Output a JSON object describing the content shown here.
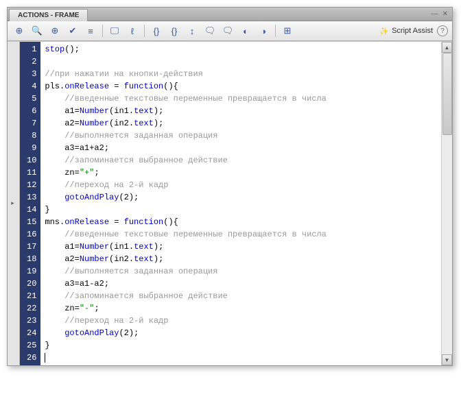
{
  "panel": {
    "title": "ACTIONS - FRAME",
    "script_assist": "Script Assist"
  },
  "toolbar": {
    "icons": [
      "plus-script",
      "find",
      "target",
      "check",
      "format",
      "insert-target",
      "snippet",
      "bracket-in",
      "bracket-out",
      "bracket-swap",
      "comment",
      "uncomment",
      "debug-1",
      "debug-2",
      "debug-3",
      "collapse"
    ],
    "wand": "✨"
  },
  "code": {
    "lines": [
      {
        "n": 1,
        "segs": [
          [
            "fn",
            "stop"
          ],
          [
            "id",
            "();"
          ]
        ]
      },
      {
        "n": 2,
        "segs": []
      },
      {
        "n": 3,
        "segs": [
          [
            "cm",
            "//при нажатии на кнопки-действия"
          ]
        ]
      },
      {
        "n": 4,
        "segs": [
          [
            "id",
            "pls."
          ],
          [
            "fn",
            "onRelease"
          ],
          [
            "id",
            " = "
          ],
          [
            "kw",
            "function"
          ],
          [
            "id",
            "(){"
          ]
        ]
      },
      {
        "n": 5,
        "segs": [
          [
            "id",
            "    "
          ],
          [
            "cm",
            "//введенные текстовые переменные превращается в числа"
          ]
        ]
      },
      {
        "n": 6,
        "segs": [
          [
            "id",
            "    a1="
          ],
          [
            "fn",
            "Number"
          ],
          [
            "id",
            "(in1."
          ],
          [
            "fn",
            "text"
          ],
          [
            "id",
            ");"
          ]
        ]
      },
      {
        "n": 7,
        "segs": [
          [
            "id",
            "    a2="
          ],
          [
            "fn",
            "Number"
          ],
          [
            "id",
            "(in2."
          ],
          [
            "fn",
            "text"
          ],
          [
            "id",
            ");"
          ]
        ]
      },
      {
        "n": 8,
        "segs": [
          [
            "id",
            "    "
          ],
          [
            "cm",
            "//выполняется заданная операция"
          ]
        ]
      },
      {
        "n": 9,
        "segs": [
          [
            "id",
            "    a3=a1+a2;"
          ]
        ]
      },
      {
        "n": 10,
        "segs": [
          [
            "id",
            "    "
          ],
          [
            "cm",
            "//запоминается выбранное действие"
          ]
        ]
      },
      {
        "n": 11,
        "segs": [
          [
            "id",
            "    zn="
          ],
          [
            "str",
            "\"+\""
          ],
          [
            "id",
            ";"
          ]
        ]
      },
      {
        "n": 12,
        "segs": [
          [
            "id",
            "    "
          ],
          [
            "cm",
            "//переход на 2-й кадр"
          ]
        ]
      },
      {
        "n": 13,
        "segs": [
          [
            "id",
            "    "
          ],
          [
            "fn",
            "gotoAndPlay"
          ],
          [
            "id",
            "(2);"
          ]
        ]
      },
      {
        "n": 14,
        "segs": [
          [
            "id",
            "}"
          ]
        ]
      },
      {
        "n": 15,
        "segs": [
          [
            "id",
            "mns."
          ],
          [
            "fn",
            "onRelease"
          ],
          [
            "id",
            " = "
          ],
          [
            "kw",
            "function"
          ],
          [
            "id",
            "(){"
          ]
        ]
      },
      {
        "n": 16,
        "segs": [
          [
            "id",
            "    "
          ],
          [
            "cm",
            "//введенные текстовые переменные превращается в числа"
          ]
        ]
      },
      {
        "n": 17,
        "segs": [
          [
            "id",
            "    a1="
          ],
          [
            "fn",
            "Number"
          ],
          [
            "id",
            "(in1."
          ],
          [
            "fn",
            "text"
          ],
          [
            "id",
            ");"
          ]
        ]
      },
      {
        "n": 18,
        "segs": [
          [
            "id",
            "    a2="
          ],
          [
            "fn",
            "Number"
          ],
          [
            "id",
            "(in2."
          ],
          [
            "fn",
            "text"
          ],
          [
            "id",
            ");"
          ]
        ]
      },
      {
        "n": 19,
        "segs": [
          [
            "id",
            "    "
          ],
          [
            "cm",
            "//выполняется заданная операция"
          ]
        ]
      },
      {
        "n": 20,
        "segs": [
          [
            "id",
            "    a3=a1-a2;"
          ]
        ]
      },
      {
        "n": 21,
        "segs": [
          [
            "id",
            "    "
          ],
          [
            "cm",
            "//запоминается выбранное действие"
          ]
        ]
      },
      {
        "n": 22,
        "segs": [
          [
            "id",
            "    zn="
          ],
          [
            "str",
            "\"-\""
          ],
          [
            "id",
            ";"
          ]
        ]
      },
      {
        "n": 23,
        "segs": [
          [
            "id",
            "    "
          ],
          [
            "cm",
            "//переход на 2-й кадр"
          ]
        ]
      },
      {
        "n": 24,
        "segs": [
          [
            "id",
            "    "
          ],
          [
            "fn",
            "gotoAndPlay"
          ],
          [
            "id",
            "(2);"
          ]
        ]
      },
      {
        "n": 25,
        "segs": [
          [
            "id",
            "}"
          ]
        ]
      },
      {
        "n": 26,
        "segs": [],
        "cursor": true
      }
    ]
  }
}
